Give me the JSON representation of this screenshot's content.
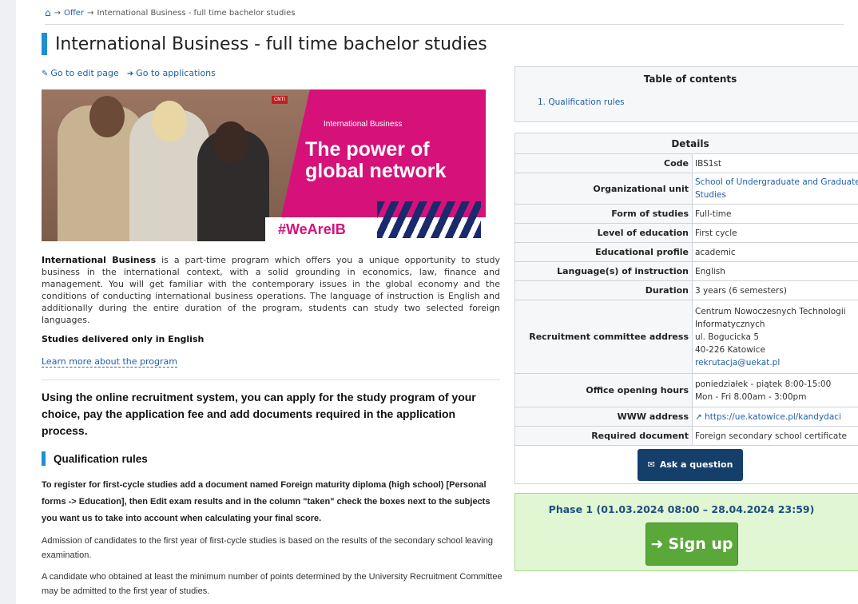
{
  "breadcrumb": {
    "offer": "Offer",
    "current": "International Business - full time bachelor studies"
  },
  "page": {
    "title": "International Business - full time bachelor studies"
  },
  "actions": {
    "edit": "Go to edit page",
    "applications": "Go to applications"
  },
  "banner": {
    "small_label": "International Business",
    "headline_1": "The power of",
    "headline_2": "global network",
    "hashtag": "#WeAreIB",
    "sign": "CNTI"
  },
  "intro": {
    "program_name": "International Business",
    "text": "is a part-time program which offers you a unique opportunity to study business in the international context, with a solid grounding in economics, law, finance and management. You will get familiar with the contemporary issues in the global economy and the conditions of conducting international business operations. The language of instruction is English and additionally during the entire duration of the program, students can study two selected foreign languages.",
    "delivered": "Studies delivered only in English",
    "learn_more": "Learn more about the program"
  },
  "online_system": "Using the online recruitment system, you can apply for the study program of your choice, pay the application fee and add documents required in the application process.",
  "qualification": {
    "heading": "Qualification rules",
    "p1": "To register for first-cycle studies add a document named Foreign maturity diploma (high school) [Personal forms -> Education], then Edit exam results and in the column \"taken\" check the boxes next to the subjects you want us to take into account when calculating your final score.",
    "p2": "Admission of candidates to the first year of first-cycle studies is based on the results of the secondary school leaving examination.",
    "p3": "A candidate who obtained at least the minimum number of points determined by the University Recruitment Committee may be admitted to the first year of studies."
  },
  "toc": {
    "title": "Table of contents",
    "items": [
      "1. Qualification rules"
    ]
  },
  "details": {
    "title": "Details",
    "rows": {
      "code": {
        "label": "Code",
        "value": "IBS1st"
      },
      "unit": {
        "label": "Organizational unit",
        "value": "School of Undergraduate and Graduate Studies"
      },
      "form": {
        "label": "Form of studies",
        "value": "Full-time"
      },
      "level": {
        "label": "Level of education",
        "value": "First cycle"
      },
      "profile": {
        "label": "Educational profile",
        "value": "academic"
      },
      "language": {
        "label": "Language(s) of instruction",
        "value": "English"
      },
      "duration": {
        "label": "Duration",
        "value": "3 years (6 semesters)"
      },
      "address": {
        "label": "Recruitment committee address",
        "line1": "Centrum Nowoczesnych Technologii",
        "line2": "Informatycznych",
        "line3": "ul. Bogucicka 5",
        "line4": "40-226 Katowice",
        "email": "rekrutacja@uekat.pl"
      },
      "hours": {
        "label": "Office opening hours",
        "line1": "poniedziałek - piątek 8:00-15:00",
        "line2": "Mon - Fri 8.00am - 3:00pm"
      },
      "www": {
        "label": "WWW address",
        "value": "https://ue.katowice.pl/kandydaci"
      },
      "document": {
        "label": "Required document",
        "value": "Foreign secondary school certificate"
      }
    },
    "ask_button": "Ask a question"
  },
  "phase": {
    "title": "Phase 1 (01.03.2024 08:00 – 28.04.2024 23:59)",
    "signup": "Sign up"
  },
  "colors": {
    "accent_blue": "#1e90d2",
    "link": "#1f5fa8",
    "navy_button": "#153f6b",
    "signup_green": "#5aa83a",
    "phase_bg": "#e1f6d2",
    "banner_pink": "#d6117a"
  },
  "icons": {
    "home": "home-icon",
    "arrow": "arrow-right-icon",
    "edit": "edit-icon",
    "sign_in": "sign-in-icon",
    "external": "external-link-icon",
    "envelope": "envelope-icon"
  }
}
